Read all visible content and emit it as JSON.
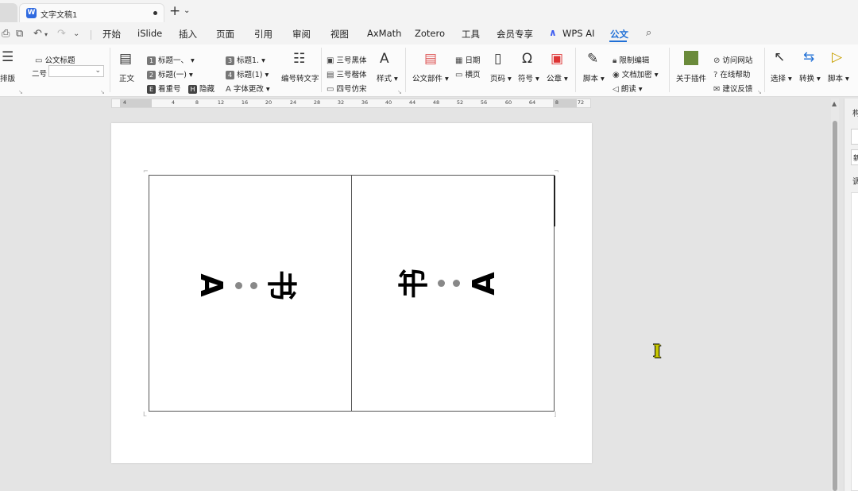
{
  "window": {
    "doc_tab_title": "文字文稿1",
    "app_icon_letter": "W",
    "new_tab_symbol": "+",
    "tab_dropdown": "⌄"
  },
  "menu": {
    "items": [
      "开始",
      "iSlide",
      "插入",
      "页面",
      "引用",
      "审阅",
      "视图",
      "AxMath",
      "Zotero",
      "工具",
      "会员专享",
      "WPS AI",
      "公文"
    ],
    "active": "公文"
  },
  "ribbon": {
    "layout_label": "排版",
    "doc_title_label": "公文标题",
    "font_size_value": "二号",
    "body_text": "正文",
    "heading1": "标题一、",
    "heading2": "标题(一)",
    "heading3": "标题1.",
    "heading4": "标题(1)",
    "n1": "1",
    "n2": "2",
    "n3": "3",
    "n4": "4",
    "heavy_num": "看重号",
    "hide": "隐藏",
    "font_change": "字体更改",
    "number_to_text": "编号转文字",
    "font_black": "三号黑体",
    "font_kai": "三号楷体",
    "font_fangsong": "四号仿宋",
    "style": "样式",
    "doc_parts": "公文部件",
    "date": "日期",
    "landscape": "横页",
    "page_num": "页码",
    "symbol": "符号",
    "seal": "公章",
    "script": "脚本",
    "restrict_edit": "限制编辑",
    "doc_encrypt": "文档加密",
    "read_aloud": "朗读",
    "about_plugin": "关于插件",
    "visit_site": "访问网站",
    "online_help": "在线帮助",
    "feedback": "建议反馈",
    "select": "选择",
    "convert": "转换",
    "script2": "脚本"
  },
  "ruler": {
    "ticks": [
      "4",
      "4",
      "8",
      "12",
      "16",
      "20",
      "24",
      "28",
      "32",
      "36",
      "40",
      "44",
      "48",
      "52",
      "56",
      "60",
      "64",
      "8",
      "72"
    ]
  },
  "document": {
    "left_cell": {
      "char": "书",
      "letter": "A"
    },
    "right_cell": {
      "char": "书",
      "letter": "A"
    }
  },
  "sidepanel": {
    "labels": [
      "构",
      "新",
      "调"
    ]
  },
  "colors": {
    "accent": "#1f6fd6",
    "wps_ai": "#3b5bf0",
    "app_icon": "#2f6ae0"
  }
}
